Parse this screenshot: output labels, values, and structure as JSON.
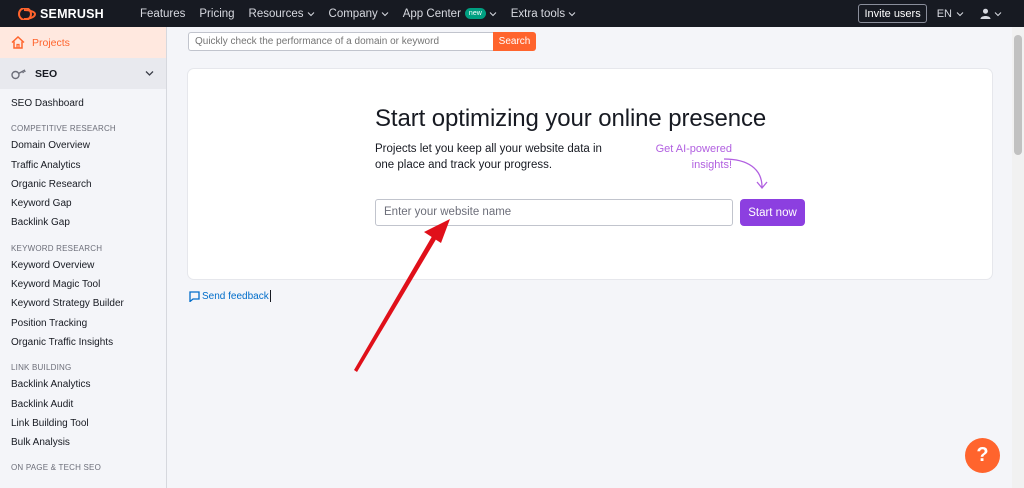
{
  "topbar": {
    "brand": "SEMRUSH",
    "nav": [
      {
        "label": "Features"
      },
      {
        "label": "Pricing"
      },
      {
        "label": "Resources"
      },
      {
        "label": "Company"
      },
      {
        "label": "App Center"
      },
      {
        "label": "Extra tools"
      }
    ],
    "new_badge": "new",
    "invite_label": "Invite users",
    "language": "EN"
  },
  "sidebar": {
    "projects_label": "Projects",
    "seo_label": "SEO",
    "seo_dashboard": "SEO Dashboard",
    "sections": [
      {
        "heading": "COMPETITIVE RESEARCH",
        "items": [
          "Domain Overview",
          "Traffic Analytics",
          "Organic Research",
          "Keyword Gap",
          "Backlink Gap"
        ]
      },
      {
        "heading": "KEYWORD RESEARCH",
        "items": [
          "Keyword Overview",
          "Keyword Magic Tool",
          "Keyword Strategy Builder",
          "Position Tracking",
          "Organic Traffic Insights"
        ]
      },
      {
        "heading": "LINK BUILDING",
        "items": [
          "Backlink Analytics",
          "Backlink Audit",
          "Link Building Tool",
          "Bulk Analysis"
        ]
      },
      {
        "heading": "ON PAGE & TECH SEO",
        "items": []
      }
    ]
  },
  "search": {
    "placeholder": "Quickly check the performance of a domain or keyword",
    "button": "Search"
  },
  "card": {
    "title": "Start optimizing your online presence",
    "description": "Projects let you keep all your website data in one place and track your progress.",
    "ai_hint": "Get AI-powered insights!",
    "input_placeholder": "Enter your website name",
    "start_button": "Start now"
  },
  "feedback": {
    "label": "Send feedback"
  },
  "help": {
    "label": "?"
  },
  "colors": {
    "brand_orange": "#ff642d",
    "topbar_bg": "#171a22",
    "start_purple": "#8c3fe0",
    "ai_hint_purple": "#b15fe0",
    "annotation_red": "#e0101a"
  }
}
